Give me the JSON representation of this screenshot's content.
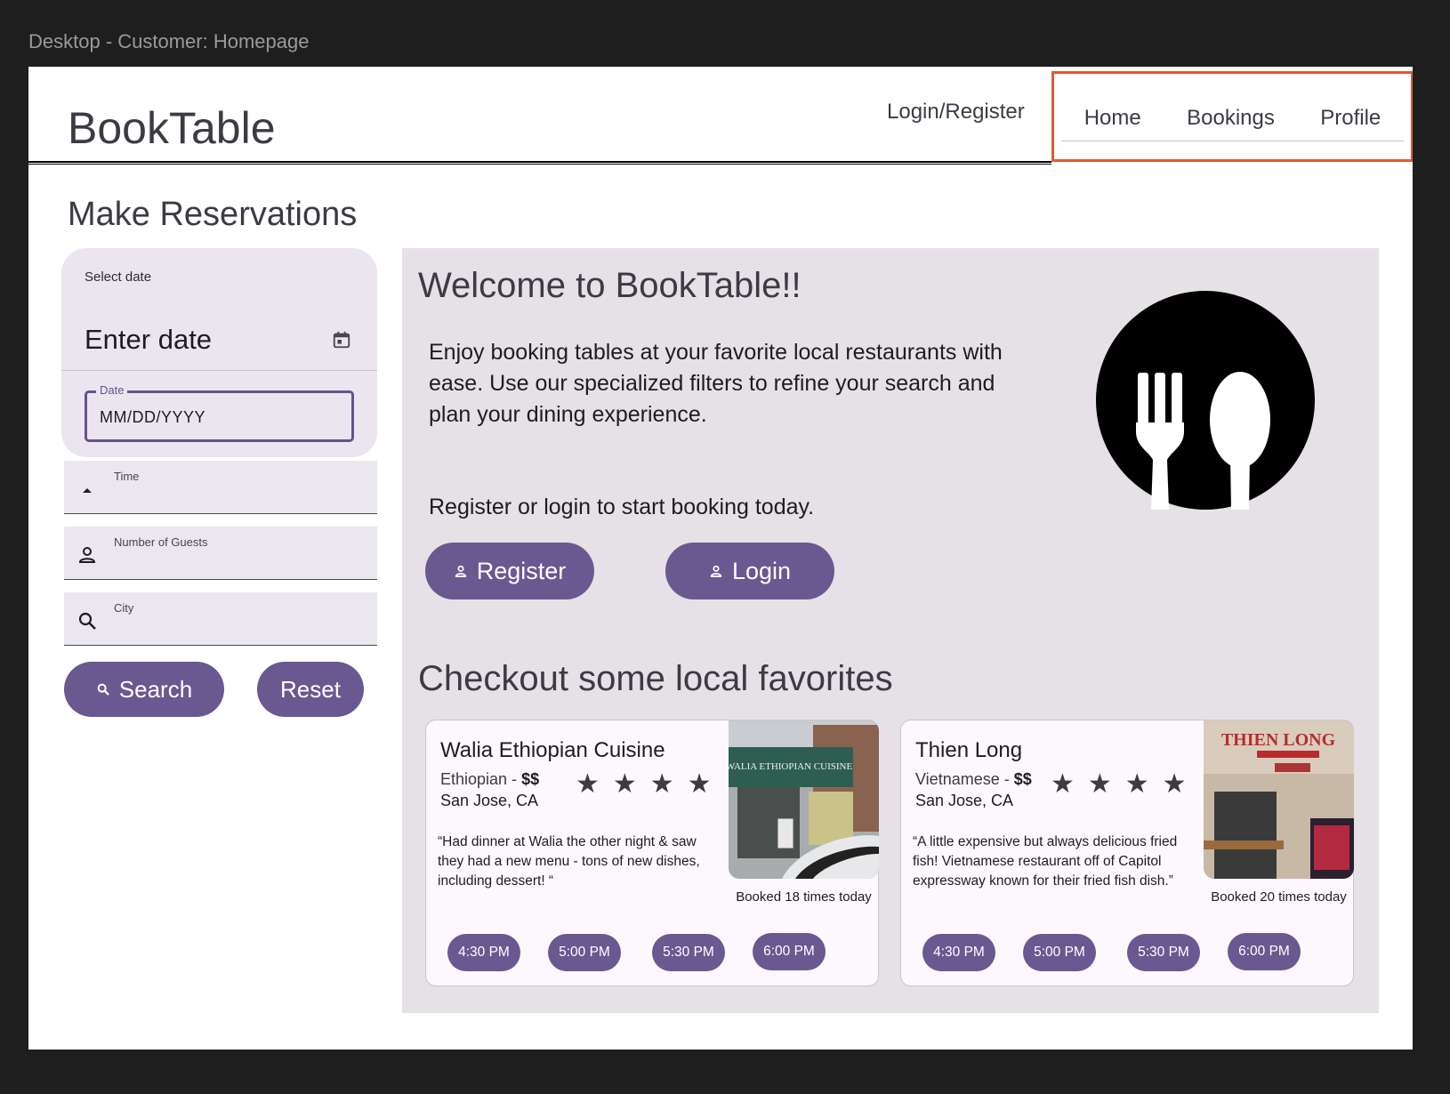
{
  "frame_label": "Desktop - Customer: Homepage",
  "header": {
    "brand": "BookTable",
    "login_link": "Login/Register",
    "tabs": [
      "Home",
      "Bookings",
      "Profile"
    ]
  },
  "reservations": {
    "title": "Make Reservations",
    "date_picker": {
      "select_label": "Select date",
      "headline": "Enter date",
      "field_label": "Date",
      "field_value": "MM/DD/YYYY"
    },
    "time_label": "Time",
    "guests_label": "Number of Guests",
    "city_label": "City",
    "search_label": "Search",
    "reset_label": "Reset"
  },
  "welcome": {
    "title": "Welcome to BookTable!!",
    "intro": "Enjoy booking tables at your favorite local restaurants with ease. Use our specialized filters to refine your search and plan your dining experience.",
    "cta": "Register or login to start booking today.",
    "register_label": "Register",
    "login_label": "Login"
  },
  "favorites": {
    "title": "Checkout some local favorites",
    "restaurants": [
      {
        "name": "Walia Ethiopian Cuisine",
        "cuisine": "Ethiopian - ",
        "price": "$$",
        "location": "San Jose, CA",
        "stars": "★★★★",
        "rating": 4,
        "review": "“Had dinner at Walia the other night & saw they had a new menu - tons of new dishes, including  dessert! “",
        "sign": "WALIA ETHIOPIAN CUISINE",
        "booked": "Booked 18 times today",
        "slots": [
          "4:30 PM",
          "5:00 PM",
          "5:30 PM",
          "6:00 PM"
        ]
      },
      {
        "name": "Thien Long",
        "cuisine": "Vietnamese - ",
        "price": "$$",
        "location": "San Jose, CA",
        "stars": "★★★★",
        "rating": 4,
        "review": "“A little expensive but always delicious fried fish! Vietnamese restaurant off of Capitol expressway  known for their fried fish dish.”",
        "sign": "THIEN LONG",
        "booked": "Booked 20 times today",
        "slots": [
          "4:30 PM",
          "5:00 PM",
          "5:30 PM",
          "6:00 PM"
        ]
      }
    ]
  },
  "colors": {
    "accent": "#6a5891",
    "panel": "#e6e1e7",
    "highlight": "#e05a35"
  },
  "icons": [
    "calendar-icon",
    "caret-up-icon",
    "person-icon",
    "search-icon",
    "fork-spoon-logo-icon",
    "star-icon"
  ]
}
